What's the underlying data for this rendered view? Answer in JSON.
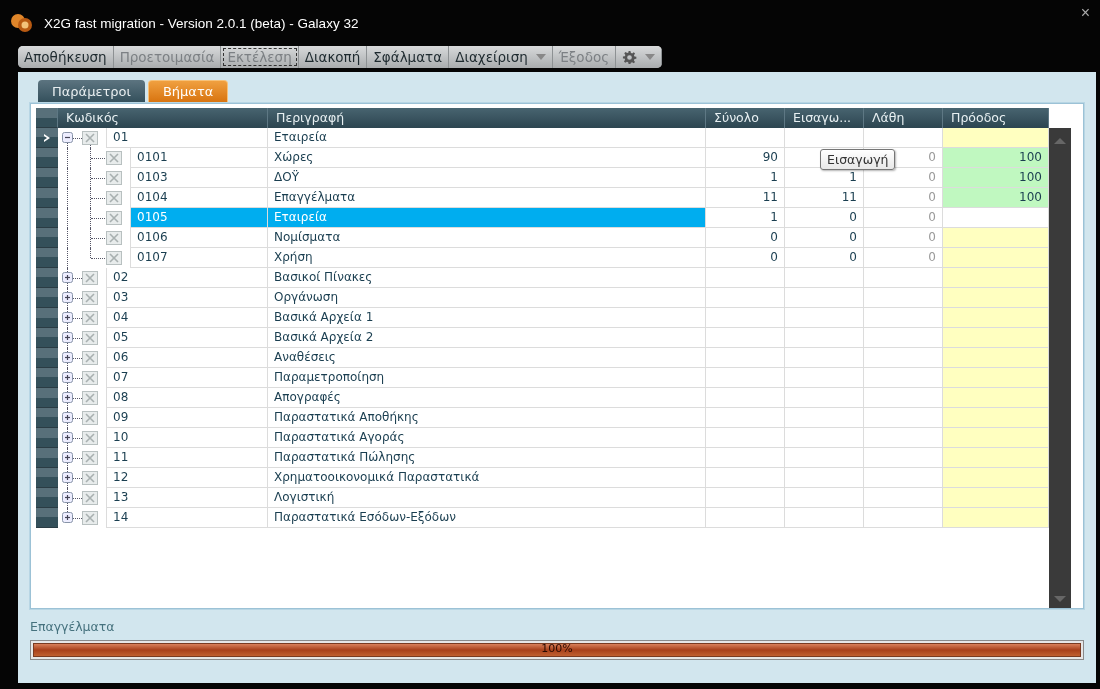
{
  "window": {
    "title": "X2G fast migration - Version 2.0.1 (beta) - Galaxy 32",
    "close": "×"
  },
  "toolbar": [
    {
      "label": "Αποθήκευση",
      "disabled": false,
      "focused": false,
      "dropdown": false
    },
    {
      "label": "Προετοιμασία",
      "disabled": true,
      "focused": false,
      "dropdown": false
    },
    {
      "label": "Εκτέλεση",
      "disabled": true,
      "focused": true,
      "dropdown": false
    },
    {
      "label": "Διακοπή",
      "disabled": false,
      "focused": false,
      "dropdown": false
    },
    {
      "label": "Σφάλματα",
      "disabled": false,
      "focused": false,
      "dropdown": false
    },
    {
      "label": "Διαχείριση",
      "disabled": false,
      "focused": false,
      "dropdown": true
    },
    {
      "label": "Έξοδος",
      "disabled": true,
      "focused": false,
      "dropdown": false
    },
    {
      "kind": "settings",
      "disabled": false,
      "focused": false,
      "dropdown": true
    }
  ],
  "tabs": [
    {
      "label": "Παράμετροι",
      "selected": false
    },
    {
      "label": "Βήματα",
      "selected": true
    }
  ],
  "table": {
    "columns": [
      "Κωδικός",
      "Περιγραφή",
      "Σύνολο",
      "Εισαγω...",
      "Λάθη",
      "Πρόοδος"
    ],
    "rows": [
      {
        "code": "01",
        "description": "Εταιρεία",
        "current": true,
        "selected": false,
        "expanded": true,
        "color": "#ffffc0",
        "children": [
          {
            "code": "0101",
            "description": "Χώρες",
            "total": "90",
            "errors": "0",
            "progress": "100",
            "current": false,
            "selected": false,
            "color": "#c0f8c0"
          },
          {
            "code": "0103",
            "description": "ΔΟΫ",
            "total": "1",
            "imported": "1",
            "errors": "0",
            "progress": "100",
            "current": false,
            "selected": false,
            "color": "#c0f8c0"
          },
          {
            "code": "0104",
            "description": "Επαγγέλματα",
            "total": "11",
            "imported": "11",
            "errors": "0",
            "progress": "100",
            "current": false,
            "selected": false,
            "color": "#c0f8c0"
          },
          {
            "code": "0105",
            "description": "Εταιρεία",
            "total": "1",
            "imported": "0",
            "errors": "0",
            "current": false,
            "selected": true,
            "color": "#ffffff"
          },
          {
            "code": "0106",
            "description": "Νομίσματα",
            "total": "0",
            "imported": "0",
            "errors": "0",
            "current": false,
            "selected": false,
            "color": "#ffffc0"
          },
          {
            "code": "0107",
            "description": "Χρήση",
            "total": "0",
            "imported": "0",
            "errors": "0",
            "current": false,
            "selected": false,
            "color": "#ffffc0"
          }
        ]
      },
      {
        "code": "02",
        "description": "Βασικοί Πίνακες",
        "current": false,
        "selected": false,
        "expanded": false,
        "color": "#ffffc0"
      },
      {
        "code": "03",
        "description": "Οργάνωση",
        "current": false,
        "selected": false,
        "expanded": false,
        "color": "#ffffc0"
      },
      {
        "code": "04",
        "description": "Βασικά Αρχεία 1",
        "current": false,
        "selected": false,
        "expanded": false,
        "color": "#ffffc0"
      },
      {
        "code": "05",
        "description": "Βασικά Αρχεία 2",
        "current": false,
        "selected": false,
        "expanded": false,
        "color": "#ffffc0"
      },
      {
        "code": "06",
        "description": "Αναθέσεις",
        "current": false,
        "selected": false,
        "expanded": false,
        "color": "#ffffc0"
      },
      {
        "code": "07",
        "description": "Παραμετροποίηση",
        "current": false,
        "selected": false,
        "expanded": false,
        "color": "#ffffc0"
      },
      {
        "code": "08",
        "description": "Απογραφές",
        "current": false,
        "selected": false,
        "expanded": false,
        "color": "#ffffc0"
      },
      {
        "code": "09",
        "description": "Παραστατικά Αποθήκης",
        "current": false,
        "selected": false,
        "expanded": false,
        "color": "#ffffc0"
      },
      {
        "code": "10",
        "description": "Παραστατικά Αγοράς",
        "current": false,
        "selected": false,
        "expanded": false,
        "color": "#ffffc0"
      },
      {
        "code": "11",
        "description": "Παραστατικά Πώλησης",
        "current": false,
        "selected": false,
        "expanded": false,
        "color": "#ffffc0"
      },
      {
        "code": "12",
        "description": "Χρηματοοικονομικά Παραστατικά",
        "current": false,
        "selected": false,
        "expanded": false,
        "color": "#ffffc0"
      },
      {
        "code": "13",
        "description": "Λογιστική",
        "current": false,
        "selected": false,
        "expanded": false,
        "color": "#ffffc0"
      },
      {
        "code": "14",
        "description": "Παραστατικά Εσόδων-Εξόδων",
        "current": false,
        "selected": false,
        "expanded": false,
        "color": "#ffffc0"
      }
    ]
  },
  "tooltip": {
    "text": "Εισαγωγή"
  },
  "status": {
    "label": "Επαγγέλματα",
    "level": 1,
    "reading": "100%"
  }
}
